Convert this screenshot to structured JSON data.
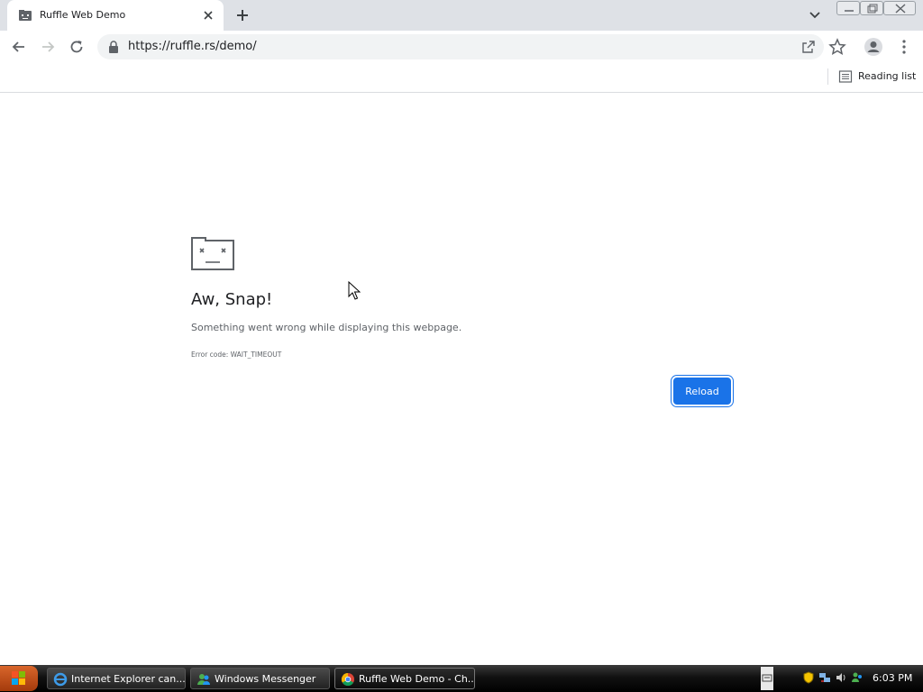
{
  "tab": {
    "title": "Ruffle Web Demo"
  },
  "address_bar": {
    "url": "https://ruffle.rs/demo/"
  },
  "bookmarks_bar": {
    "reading_list_label": "Reading list"
  },
  "error_page": {
    "heading": "Aw, Snap!",
    "message": "Something went wrong while displaying this webpage.",
    "error_code": "Error code: WAIT_TIMEOUT",
    "reload_label": "Reload"
  },
  "taskbar": {
    "tasks": [
      {
        "label": "Internet Explorer can...",
        "icon": "internet-explorer-icon"
      },
      {
        "label": "Windows Messenger",
        "icon": "windows-messenger-icon"
      },
      {
        "label": "Ruffle Web Demo - Ch...",
        "icon": "chrome-icon"
      }
    ],
    "clock": "6:03 PM"
  },
  "colors": {
    "accent": "#1a73e8",
    "tab_strip": "#dee1e6",
    "omnibox": "#f1f3f4"
  }
}
